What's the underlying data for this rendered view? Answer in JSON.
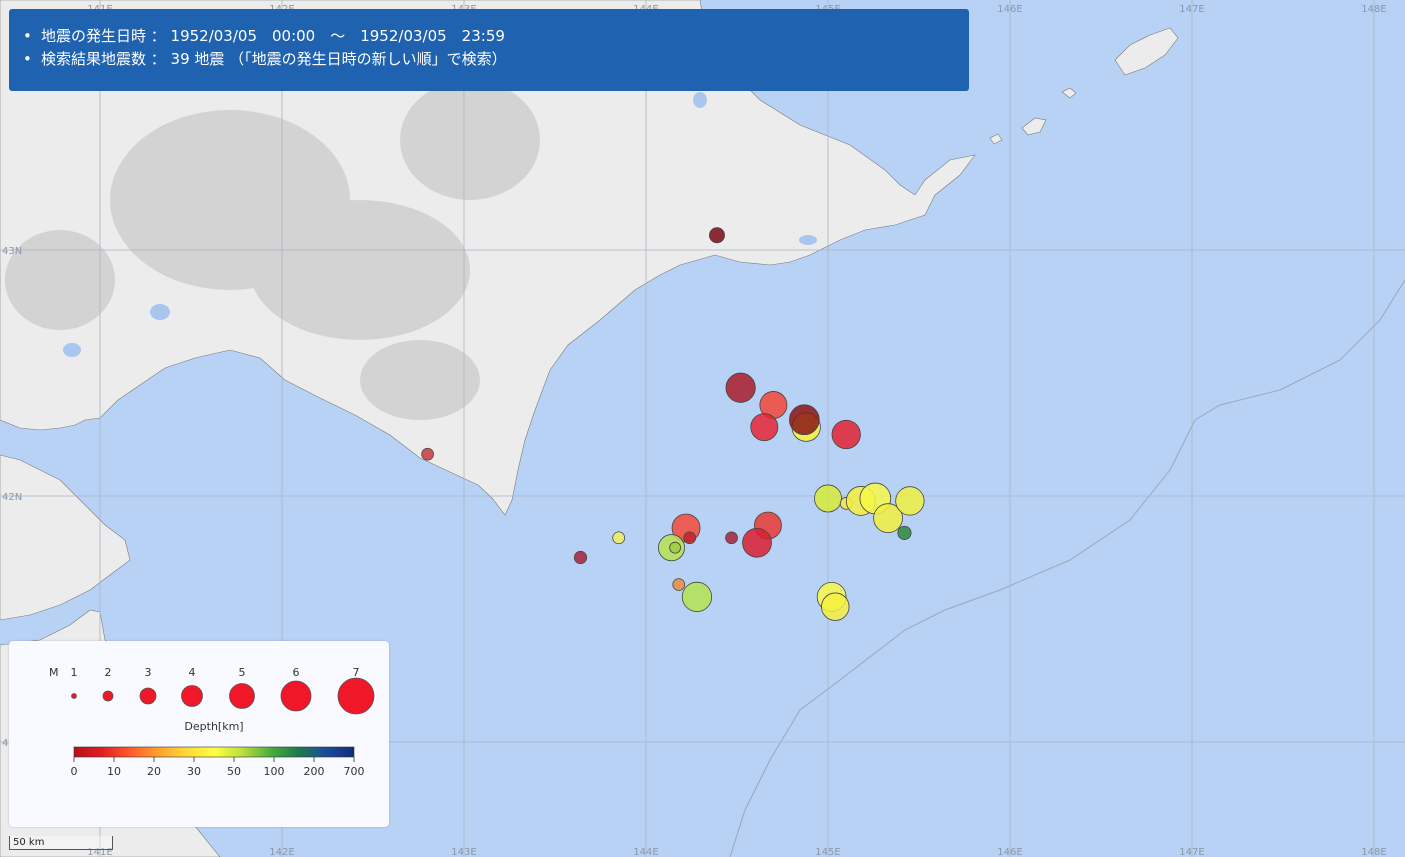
{
  "info": {
    "line1": "地震の発生日時 ： 1952/03/05　00:00　～　1952/03/05　23:59",
    "line2": "検索結果地震数 ： 39 地震 （「地震の発生日時の新しい順」で検索）"
  },
  "grid": {
    "lon_labels": [
      "141E",
      "142E",
      "143E",
      "144E",
      "145E",
      "146E",
      "147E",
      "148E"
    ],
    "lat_labels": [
      "43N",
      "42N",
      "41N"
    ]
  },
  "legend": {
    "m_label": "M",
    "magnitudes": [
      "1",
      "2",
      "3",
      "4",
      "5",
      "6",
      "7"
    ],
    "depth_title": "Depth[km]",
    "depth_ticks": [
      "0",
      "10",
      "20",
      "30",
      "50",
      "100",
      "200",
      "700"
    ],
    "depth_colors": [
      "#b5101a",
      "#e11d22",
      "#ff5a2a",
      "#ffa030",
      "#ffd838",
      "#ffff40",
      "#bde03c",
      "#4cae3c",
      "#1c7a4a",
      "#1c4c9c",
      "#102a7a"
    ]
  },
  "scale": {
    "label": "50 km"
  },
  "colors": {
    "land": "#ececec",
    "sea": "#b8d2f6",
    "grid": "#a7b5c6",
    "panel": "#1f62b0"
  },
  "earthquakes": [
    {
      "lon": 144.39,
      "lat": 43.06,
      "m": 2.2,
      "color": "#7a0a14"
    },
    {
      "lon": 142.8,
      "lat": 42.17,
      "m": 1.5,
      "color": "#c63b3b"
    },
    {
      "lon": 144.52,
      "lat": 42.44,
      "m": 5.3,
      "color": "#a81c2a"
    },
    {
      "lon": 144.7,
      "lat": 42.37,
      "m": 4.8,
      "color": "#f24638"
    },
    {
      "lon": 144.88,
      "lat": 42.28,
      "m": 5.1,
      "color": "#f7f440"
    },
    {
      "lon": 144.65,
      "lat": 42.28,
      "m": 4.8,
      "color": "#e42634"
    },
    {
      "lon": 144.87,
      "lat": 42.31,
      "m": 5.4,
      "color": "#8a1514"
    },
    {
      "lon": 145.1,
      "lat": 42.25,
      "m": 5.1,
      "color": "#e02232"
    },
    {
      "lon": 145.0,
      "lat": 41.99,
      "m": 4.8,
      "color": "#d6ea3a"
    },
    {
      "lon": 145.1,
      "lat": 41.97,
      "m": 1.5,
      "color": "#f5e848"
    },
    {
      "lon": 145.18,
      "lat": 41.98,
      "m": 5.2,
      "color": "#f5f040"
    },
    {
      "lon": 145.26,
      "lat": 41.99,
      "m": 5.6,
      "color": "#f8f848"
    },
    {
      "lon": 145.33,
      "lat": 41.91,
      "m": 5.2,
      "color": "#f2f040"
    },
    {
      "lon": 145.45,
      "lat": 41.98,
      "m": 5.1,
      "color": "#f0f040"
    },
    {
      "lon": 145.42,
      "lat": 41.85,
      "m": 1.8,
      "color": "#2f8a3a"
    },
    {
      "lon": 144.22,
      "lat": 41.87,
      "m": 5.0,
      "color": "#f24a3a"
    },
    {
      "lon": 144.24,
      "lat": 41.83,
      "m": 1.5,
      "color": "#c02428"
    },
    {
      "lon": 144.14,
      "lat": 41.79,
      "m": 4.6,
      "color": "#b8e050"
    },
    {
      "lon": 144.16,
      "lat": 41.79,
      "m": 1.3,
      "color": "#9fcc40"
    },
    {
      "lon": 144.47,
      "lat": 41.83,
      "m": 1.5,
      "color": "#a5253a"
    },
    {
      "lon": 144.67,
      "lat": 41.88,
      "m": 4.8,
      "color": "#e83a34"
    },
    {
      "lon": 144.61,
      "lat": 41.81,
      "m": 5.2,
      "color": "#d81e30"
    },
    {
      "lon": 143.85,
      "lat": 41.83,
      "m": 1.5,
      "color": "#f0f060"
    },
    {
      "lon": 143.64,
      "lat": 41.75,
      "m": 1.6,
      "color": "#a5253a"
    },
    {
      "lon": 144.18,
      "lat": 41.64,
      "m": 1.5,
      "color": "#ee8a3a"
    },
    {
      "lon": 144.28,
      "lat": 41.59,
      "m": 5.3,
      "color": "#b4e450"
    },
    {
      "lon": 145.02,
      "lat": 41.59,
      "m": 5.2,
      "color": "#f8f848"
    },
    {
      "lon": 145.04,
      "lat": 41.55,
      "m": 4.9,
      "color": "#f5f040"
    }
  ]
}
